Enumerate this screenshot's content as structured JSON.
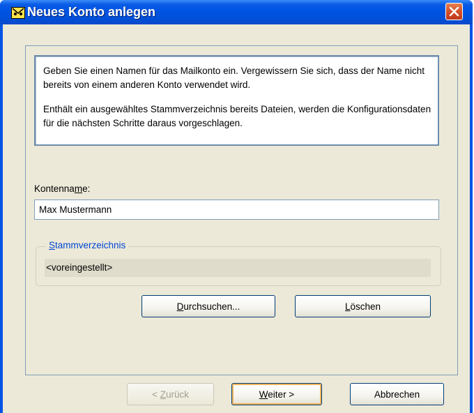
{
  "window": {
    "title": "Neues Konto anlegen"
  },
  "info": {
    "paragraph1": "Geben Sie einen Namen für das Mailkonto ein. Vergewissern Sie sich, dass der Name nicht bereits von einem anderen Konto verwendet wird.",
    "paragraph2": "Enthält ein ausgewähltes Stammverzeichnis bereits Dateien, werden die Konfigurationsdaten für die nächsten Schritte daraus vorgeschlagen."
  },
  "account_name": {
    "label_pre": "Kontenna",
    "label_accel": "m",
    "label_post": "e:",
    "value": "Max Mustermann"
  },
  "root_dir": {
    "legend_accel": "S",
    "legend_rest": "tammverzeichnis",
    "value": "<voreingestellt>"
  },
  "buttons": {
    "browse_accel": "D",
    "browse_rest": "urchsuchen...",
    "delete_accel": "L",
    "delete_rest": "öschen"
  },
  "nav": {
    "back_pre": "< ",
    "back_accel": "Z",
    "back_rest": "urück",
    "next_accel": "W",
    "next_rest": "eiter >",
    "cancel": "Abbrechen"
  },
  "colors": {
    "titlebar": "#0054e3",
    "dialog_bg": "#ece9d8",
    "accent_link": "#0046d5",
    "close_button": "#d5502a"
  },
  "icons": {
    "app": "mail-app-icon",
    "close": "close-icon"
  }
}
